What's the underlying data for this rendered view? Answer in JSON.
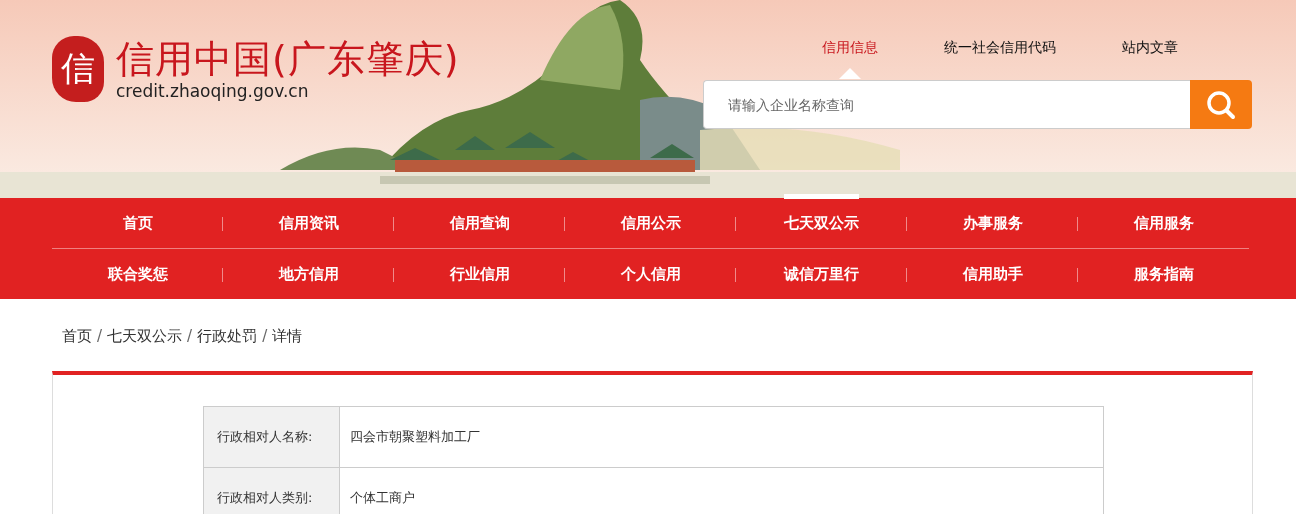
{
  "header": {
    "seal": "信",
    "title": "信用中国(广东肇庆)",
    "domain": "credit.zhaoqing.gov.cn",
    "search_tabs": [
      {
        "label": "信用信息",
        "selected": true
      },
      {
        "label": "统一社会信用代码",
        "selected": false
      },
      {
        "label": "站内文章",
        "selected": false
      }
    ],
    "search": {
      "placeholder": "请输入企业名称查询"
    }
  },
  "nav": {
    "rows": [
      [
        {
          "label": "首页",
          "selected": false
        },
        {
          "label": "信用资讯",
          "selected": false
        },
        {
          "label": "信用查询",
          "selected": false
        },
        {
          "label": "信用公示",
          "selected": false
        },
        {
          "label": "七天双公示",
          "selected": true
        },
        {
          "label": "办事服务",
          "selected": false
        },
        {
          "label": "信用服务",
          "selected": false
        }
      ],
      [
        {
          "label": "联合奖惩",
          "selected": false
        },
        {
          "label": "地方信用",
          "selected": false
        },
        {
          "label": "行业信用",
          "selected": false
        },
        {
          "label": "个人信用",
          "selected": false
        },
        {
          "label": "诚信万里行",
          "selected": false
        },
        {
          "label": "信用助手",
          "selected": false
        },
        {
          "label": "服务指南",
          "selected": false
        }
      ]
    ]
  },
  "breadcrumb": [
    {
      "kind": "link",
      "text": "首页"
    },
    {
      "kind": "separator",
      "text": "/"
    },
    {
      "kind": "link",
      "text": "七天双公示"
    },
    {
      "kind": "separator",
      "text": "/"
    },
    {
      "kind": "link",
      "text": "行政处罚"
    },
    {
      "kind": "separator",
      "text": "/"
    },
    {
      "kind": "link",
      "text": "详情"
    }
  ],
  "details": [
    {
      "label": "行政相对人名称:",
      "value": "四会市朝聚塑料加工厂"
    },
    {
      "label": "行政相对人类别:",
      "value": "个体工商户"
    }
  ]
}
